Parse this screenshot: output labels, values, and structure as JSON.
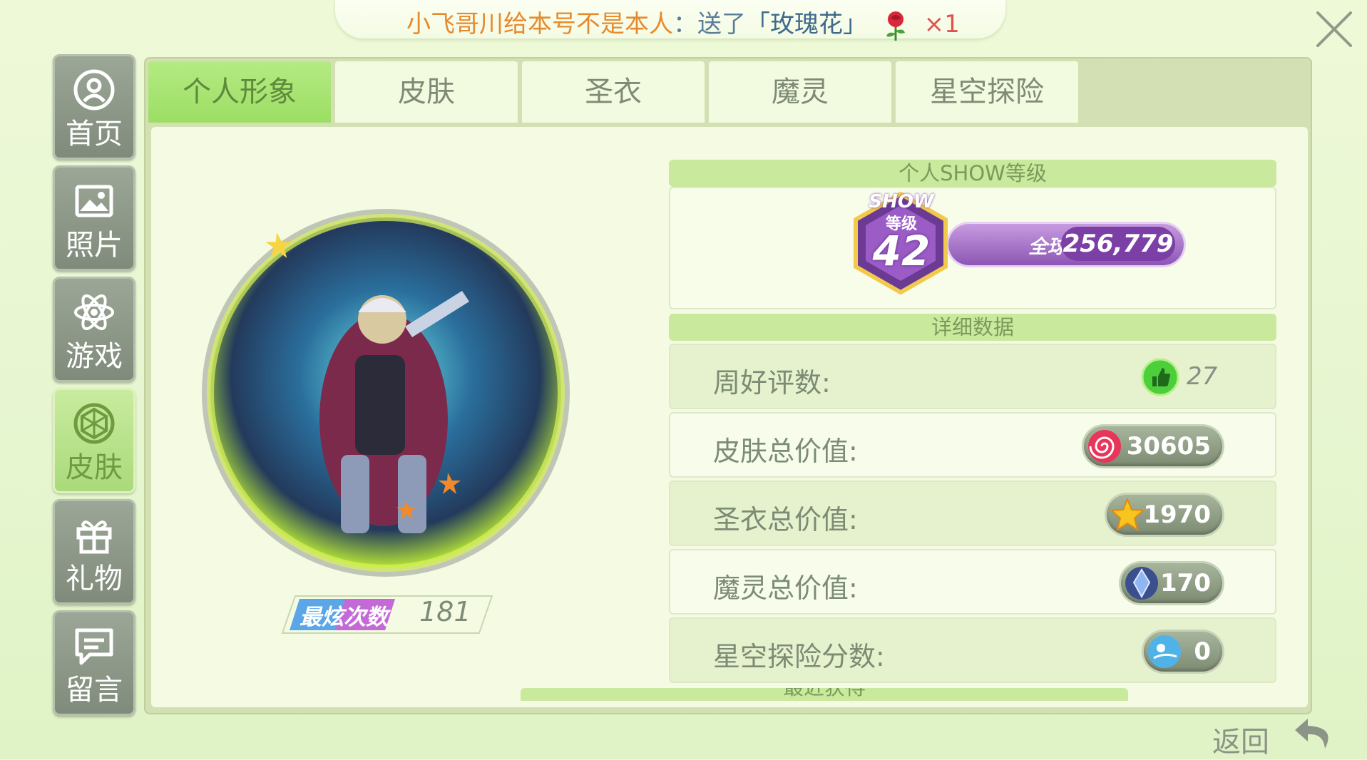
{
  "banner": {
    "sender": "小飞哥川给本号不是本人",
    "action": "：送了",
    "gift": "「玫瑰花」",
    "count": "×1"
  },
  "sidebar": {
    "items": [
      {
        "label": "首页",
        "icon": "user-icon"
      },
      {
        "label": "照片",
        "icon": "photo-icon"
      },
      {
        "label": "游戏",
        "icon": "atom-icon"
      },
      {
        "label": "皮肤",
        "icon": "diamond-icon"
      },
      {
        "label": "礼物",
        "icon": "gift-icon"
      },
      {
        "label": "留言",
        "icon": "message-icon"
      }
    ],
    "active_index": 3
  },
  "tabs": [
    {
      "label": "个人形象"
    },
    {
      "label": "皮肤"
    },
    {
      "label": "圣衣"
    },
    {
      "label": "魔灵"
    },
    {
      "label": "星空探险"
    }
  ],
  "active_tab": 0,
  "profile": {
    "count_label": "最炫次数",
    "count_value": "181"
  },
  "show_level": {
    "header": "个人SHOW等级",
    "badge_word": "SHOW",
    "badge_sub": "等级",
    "level": "42",
    "rank_label": "全球排名",
    "rank_value": "256,779"
  },
  "details": {
    "header": "详细数据",
    "rows": [
      {
        "label": "周好评数:",
        "value": "27",
        "icon": "thumbs-up-icon"
      },
      {
        "label": "皮肤总价值:",
        "value": "30605",
        "icon": "swirl-candy-icon"
      },
      {
        "label": "圣衣总价值:",
        "value": "1970",
        "icon": "star-icon"
      },
      {
        "label": "魔灵总价值:",
        "value": "170",
        "icon": "crystal-icon"
      },
      {
        "label": "星空探险分数:",
        "value": "0",
        "icon": "planet-icon"
      }
    ],
    "next_header": "最近获得"
  },
  "footer": {
    "back_label": "返回"
  },
  "colors": {
    "accent_green": "#9cde64",
    "rank_purple": "#8c56b4",
    "banner_orange": "#e78a2e"
  }
}
